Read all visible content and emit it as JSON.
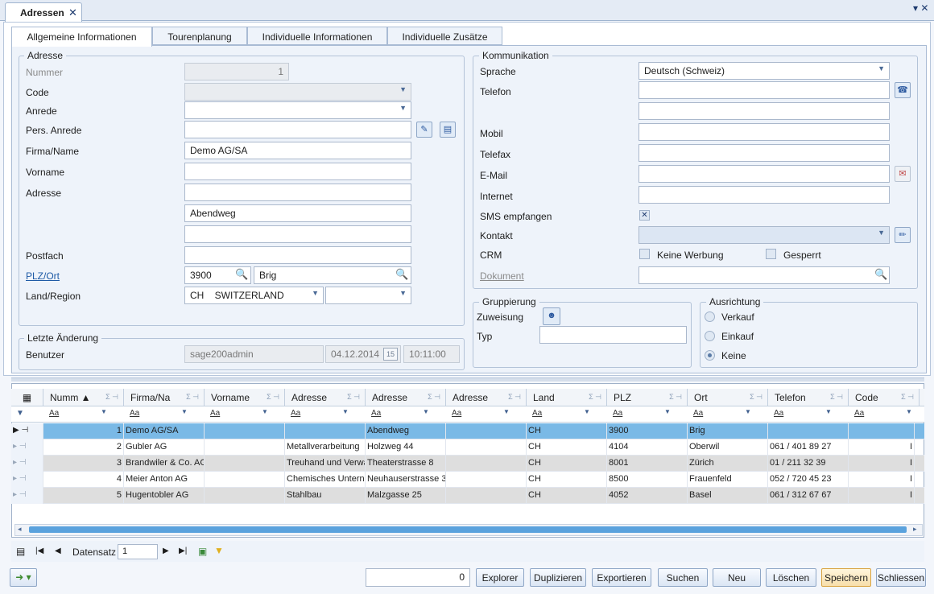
{
  "doc_tab": {
    "label": "Adressen",
    "close": "✕"
  },
  "window_controls": {
    "pin": "▾",
    "close": "✕"
  },
  "sub_tabs": [
    "Allgemeine Informationen",
    "Tourenplanung",
    "Individuelle Informationen",
    "Individuelle Zusätze"
  ],
  "adresse": {
    "title": "Adresse",
    "nummer_label": "Nummer",
    "nummer_value": "1",
    "code_label": "Code",
    "anrede_label": "Anrede",
    "pers_anrede_label": "Pers. Anrede",
    "firma_label": "Firma/Name",
    "firma_value": "Demo AG/SA",
    "vorname_label": "Vorname",
    "adresse_label": "Adresse",
    "adresse_line2": "Abendweg",
    "postfach_label": "Postfach",
    "plz_ort_label": "PLZ/Ort",
    "plz_value": "3900",
    "ort_value": "Brig",
    "land_label": "Land/Region",
    "land_value": "CH    SWITZERLAND"
  },
  "letzte_aenderung": {
    "title": "Letzte Änderung",
    "benutzer_label": "Benutzer",
    "benutzer_value": "sage200admin",
    "datum": "04.12.2014",
    "zeit": "10:11:00",
    "calendar_day": "15"
  },
  "kommunikation": {
    "title": "Kommunikation",
    "sprache_label": "Sprache",
    "sprache_value": "Deutsch (Schweiz)",
    "telefon_label": "Telefon",
    "mobil_label": "Mobil",
    "telefax_label": "Telefax",
    "email_label": "E-Mail",
    "internet_label": "Internet",
    "sms_label": "SMS empfangen",
    "kontakt_label": "Kontakt",
    "crm_label": "CRM",
    "keine_werbung_label": "Keine Werbung",
    "gesperrt_label": "Gesperrt",
    "dokument_label": "Dokument"
  },
  "gruppierung": {
    "title": "Gruppierung",
    "zuweisung_label": "Zuweisung",
    "typ_label": "Typ"
  },
  "ausrichtung": {
    "title": "Ausrichtung",
    "options": [
      "Verkauf",
      "Einkauf",
      "Keine"
    ],
    "selected": "Keine"
  },
  "grid": {
    "columns": [
      "Numm",
      "Firma/Na",
      "Vorname",
      "Adresse",
      "Adresse",
      "Adresse",
      "Land",
      "PLZ",
      "Ort",
      "Telefon",
      "Code"
    ],
    "filter_glyph": "Aa",
    "rows": [
      {
        "nummer": "1",
        "firma": "Demo AG/SA",
        "vorname": "",
        "adresse1": "",
        "adresse2": "Abendweg",
        "adresse3": "",
        "land": "CH",
        "plz": "3900",
        "ort": "Brig",
        "telefon": "",
        "code": ""
      },
      {
        "nummer": "2",
        "firma": "Gubler AG",
        "vorname": "",
        "adresse1": "Metallverarbeitung",
        "adresse2": "Holzweg 44",
        "adresse3": "",
        "land": "CH",
        "plz": "4104",
        "ort": "Oberwil",
        "telefon": "061 / 401 89 27",
        "code": "I"
      },
      {
        "nummer": "3",
        "firma": "Brandwiler & Co. AG",
        "vorname": "",
        "adresse1": "Treuhand und Verwa",
        "adresse2": "Theaterstrasse 8",
        "adresse3": "",
        "land": "CH",
        "plz": "8001",
        "ort": "Zürich",
        "telefon": "01 / 211 32 39",
        "code": "I"
      },
      {
        "nummer": "4",
        "firma": "Meier Anton AG",
        "vorname": "",
        "adresse1": "Chemisches Untern",
        "adresse2": "Neuhauserstrasse 3",
        "adresse3": "",
        "land": "CH",
        "plz": "8500",
        "ort": "Frauenfeld",
        "telefon": "052 / 720 45 23",
        "code": "I"
      },
      {
        "nummer": "5",
        "firma": "Hugentobler AG",
        "vorname": "",
        "adresse1": "Stahlbau",
        "adresse2": "Malzgasse 25",
        "adresse3": "",
        "land": "CH",
        "plz": "4052",
        "ort": "Basel",
        "telefon": "061 / 312 67 67",
        "code": "I"
      }
    ]
  },
  "navigator": {
    "label": "Datensatz",
    "value": "1"
  },
  "footer": {
    "count_value": "0",
    "buttons": [
      "Explorer",
      "Duplizieren",
      "Exportieren",
      "Suchen",
      "Neu",
      "Löschen",
      "Speichern",
      "Schliessen"
    ]
  },
  "colors": {
    "selected_row": "#7ab9e6",
    "accent": "#1f5ba6"
  }
}
